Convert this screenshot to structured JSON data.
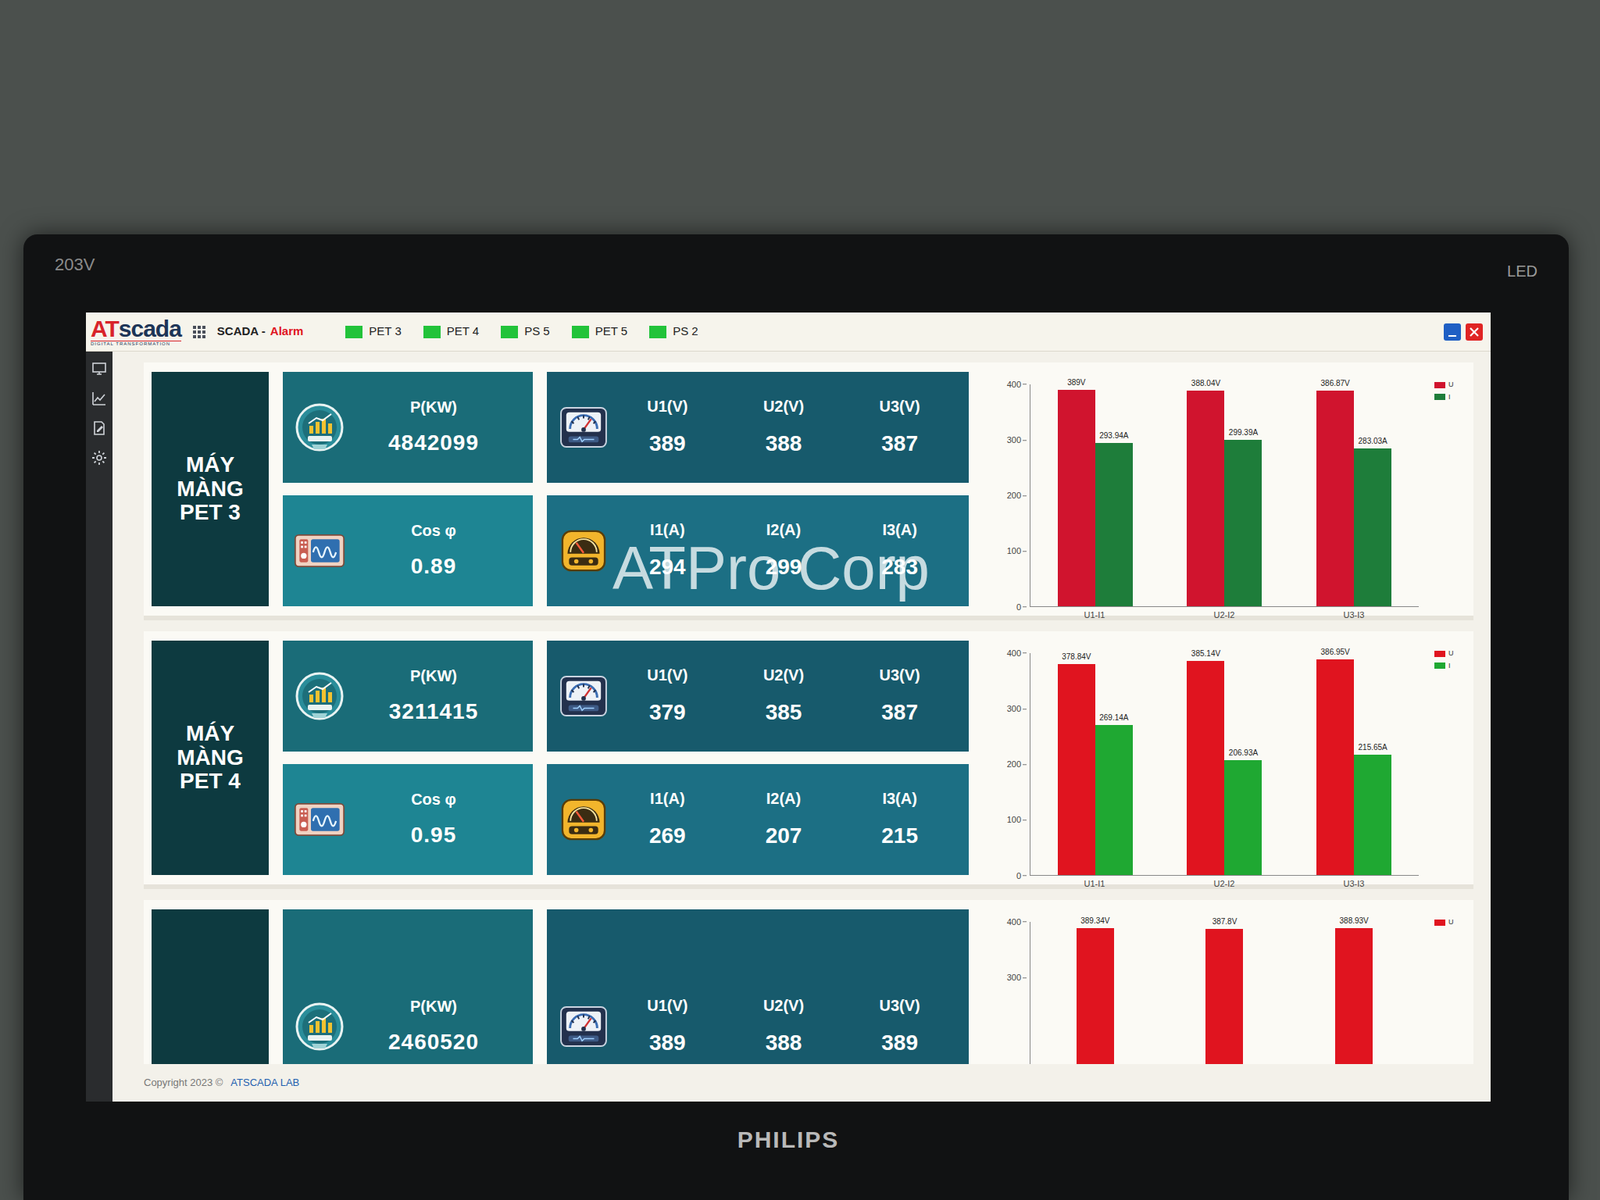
{
  "monitor": {
    "model": "203V",
    "type": "LED",
    "brand": "PHILIPS"
  },
  "app": {
    "logo_prefix": "AT",
    "logo_suffix": "scada",
    "logo_tagline": "DIGITAL TRANSFORMATION",
    "menu": "SCADA -",
    "alarm": "Alarm"
  },
  "tabs": [
    {
      "label": "PET 3",
      "color": "#22c33a"
    },
    {
      "label": "PET 4",
      "color": "#22c33a"
    },
    {
      "label": "PS 5",
      "color": "#22c33a"
    },
    {
      "label": "PET 5",
      "color": "#22c33a"
    },
    {
      "label": "PS 2",
      "color": "#22c33a"
    }
  ],
  "watermark": "ATPro Corp",
  "panels": [
    {
      "name": "MÁY MÀNG PET 3",
      "power": {
        "label": "P(KW)",
        "value": "4842099"
      },
      "cos": {
        "label": "Cos φ",
        "value": "0.89"
      },
      "voltages": [
        {
          "label": "U1(V)",
          "value": "389"
        },
        {
          "label": "U2(V)",
          "value": "388"
        },
        {
          "label": "U3(V)",
          "value": "387"
        }
      ],
      "currents": [
        {
          "label": "I1(A)",
          "value": "294"
        },
        {
          "label": "I2(A)",
          "value": "299"
        },
        {
          "label": "I3(A)",
          "value": "283"
        }
      ],
      "chart": {
        "max": 400,
        "ticks": [
          "0",
          "100",
          "200",
          "300",
          "400"
        ],
        "categories": [
          "U1-I1",
          "U2-I2",
          "U3-I3"
        ],
        "series": [
          {
            "name": "U",
            "color": "#d0142e",
            "values": [
              389,
              388.04,
              386.87
            ],
            "labels": [
              "389V",
              "388.04V",
              "386.87V"
            ]
          },
          {
            "name": "I",
            "color": "#1e7d3a",
            "values": [
              293.94,
              299.39,
              283.03
            ],
            "labels": [
              "293.94A",
              "299.39A",
              "283.03A"
            ]
          }
        ]
      }
    },
    {
      "name": "MÁY MÀNG PET 4",
      "power": {
        "label": "P(KW)",
        "value": "3211415"
      },
      "cos": {
        "label": "Cos φ",
        "value": "0.95"
      },
      "voltages": [
        {
          "label": "U1(V)",
          "value": "379"
        },
        {
          "label": "U2(V)",
          "value": "385"
        },
        {
          "label": "U3(V)",
          "value": "387"
        }
      ],
      "currents": [
        {
          "label": "I1(A)",
          "value": "269"
        },
        {
          "label": "I2(A)",
          "value": "207"
        },
        {
          "label": "I3(A)",
          "value": "215"
        }
      ],
      "chart": {
        "max": 400,
        "ticks": [
          "0",
          "100",
          "200",
          "300",
          "400"
        ],
        "categories": [
          "U1-I1",
          "U2-I2",
          "U3-I3"
        ],
        "series": [
          {
            "name": "U",
            "color": "#e0141f",
            "values": [
              378.84,
              385.14,
              386.95
            ],
            "labels": [
              "378.84V",
              "385.14V",
              "386.95V"
            ]
          },
          {
            "name": "I",
            "color": "#1fa832",
            "values": [
              269.14,
              206.93,
              215.65
            ],
            "labels": [
              "269.14A",
              "206.93A",
              "215.65A"
            ]
          }
        ]
      }
    },
    {
      "name": "",
      "power": {
        "label": "P(KW)",
        "value": "2460520"
      },
      "cos": null,
      "voltages": [
        {
          "label": "U1(V)",
          "value": "389"
        },
        {
          "label": "U2(V)",
          "value": "388"
        },
        {
          "label": "U3(V)",
          "value": "389"
        }
      ],
      "currents": null,
      "chart": {
        "max": 400,
        "ticks": [
          "300",
          "400"
        ],
        "categories": [],
        "series": [
          {
            "name": "U",
            "color": "#e0141f",
            "values": [
              389.34,
              387.8,
              388.93
            ],
            "labels": [
              "389.34V",
              "387.8V",
              "388.93V"
            ]
          }
        ]
      }
    }
  ],
  "footer": {
    "copyright": "Copyright 2023 ©",
    "lab": "ATSCADA LAB"
  }
}
